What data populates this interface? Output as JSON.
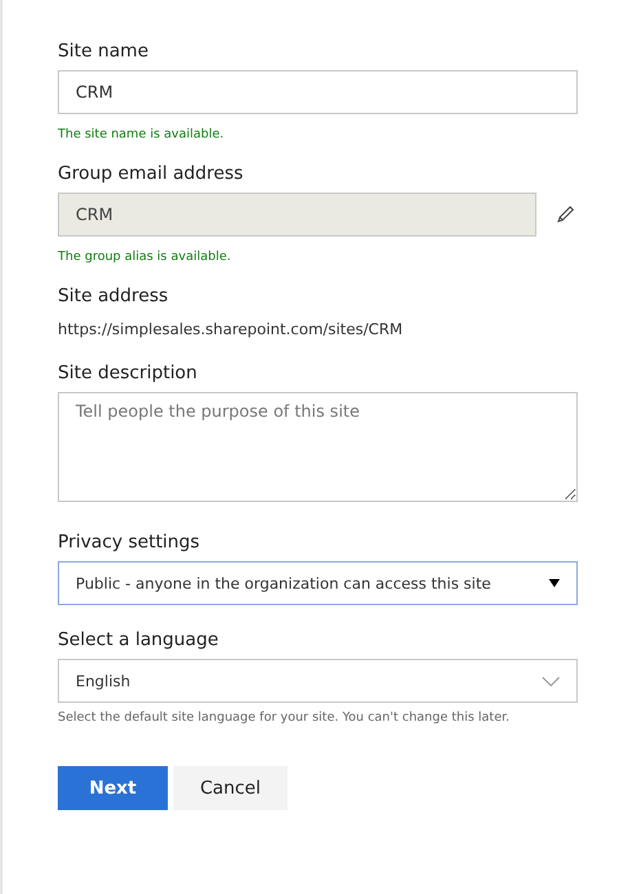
{
  "site_name": {
    "label": "Site name",
    "value": "CRM",
    "status": "The site name is available."
  },
  "group_email": {
    "label": "Group email address",
    "value": "CRM",
    "disabled": true,
    "status": "The group alias is available."
  },
  "site_address": {
    "label": "Site address",
    "value": "https://simplesales.sharepoint.com/sites/CRM"
  },
  "site_description": {
    "label": "Site description",
    "placeholder": "Tell people the purpose of this site"
  },
  "privacy": {
    "label": "Privacy settings",
    "value": "Public - anyone in the organization can access this site",
    "focused": true
  },
  "language": {
    "label": "Select a language",
    "value": "English",
    "hint": "Select the default site language for your site. You can't change this later."
  },
  "buttons": [
    {
      "label": "Next",
      "kind": "primary"
    },
    {
      "label": "Cancel",
      "kind": "secondary"
    }
  ]
}
